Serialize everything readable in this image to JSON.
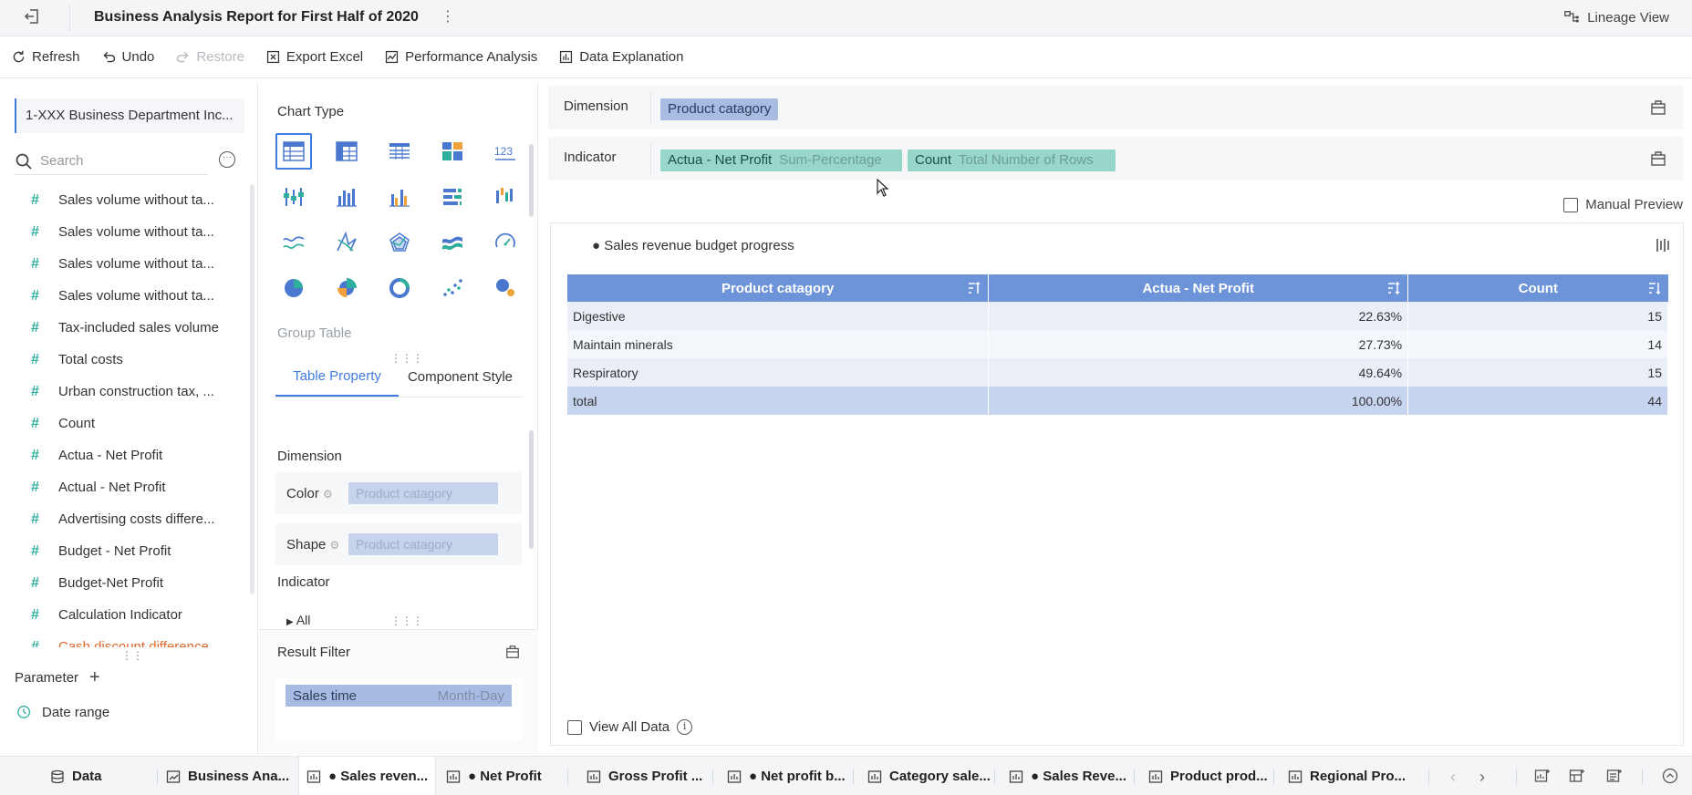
{
  "header": {
    "title": "Business Analysis Report for First Half of 2020",
    "lineage_label": "Lineage View"
  },
  "toolbar": {
    "refresh": "Refresh",
    "undo": "Undo",
    "restore": "Restore",
    "export_excel": "Export Excel",
    "performance_analysis": "Performance Analysis",
    "data_explanation": "Data Explanation"
  },
  "left_panel": {
    "dataset": "1-XXX Business Department Inc...",
    "search_placeholder": "Search",
    "fields": [
      {
        "label": "Sales volume without ta...",
        "icon": "hash-icon"
      },
      {
        "label": "Sales volume without ta...",
        "icon": "hash-icon"
      },
      {
        "label": "Sales volume without ta...",
        "icon": "hash-icon"
      },
      {
        "label": "Sales volume without ta...",
        "icon": "hash-icon"
      },
      {
        "label": "Tax-included sales volume",
        "icon": "hash-icon"
      },
      {
        "label": "Total costs",
        "icon": "hash-icon"
      },
      {
        "label": "Urban construction tax, ...",
        "icon": "hash-icon"
      },
      {
        "label": "Count",
        "icon": "hash-sparkle-icon"
      },
      {
        "label": "Actua - Net Profit",
        "icon": "hash-calc-icon"
      },
      {
        "label": "Actual - Net Profit",
        "icon": "hash-calc-icon"
      },
      {
        "label": "Advertising costs differe...",
        "icon": "hash-calc-icon"
      },
      {
        "label": "Budget - Net Profit",
        "icon": "hash-calc-icon"
      },
      {
        "label": "Budget-Net Profit",
        "icon": "hash-calc-icon"
      },
      {
        "label": "Calculation Indicator",
        "icon": "hash-calc-icon"
      },
      {
        "label": "Cash discount difference",
        "icon": "hash-calc-icon"
      }
    ],
    "parameter_label": "Parameter",
    "date_range_label": "Date range"
  },
  "middle_panel": {
    "chart_type_label": "Chart Type",
    "chart_types": [
      "group-table-icon",
      "cross-table-icon",
      "detail-table-icon",
      "kpi-card-icon",
      "number-icon",
      "custom-chart-icon",
      "column-chart-icon",
      "grouped-column-icon",
      "bar-chart-icon",
      "waterfall-icon",
      "line-chart-icon",
      "radar-icon",
      "range-radar-icon",
      "area-chart-icon",
      "gauge-icon",
      "pie-chart-icon",
      "rose-chart-icon",
      "donut-chart-icon",
      "scatter-icon",
      "bubble-icon"
    ],
    "selected_chart_name": "Group Table",
    "tabs": [
      "Table Property",
      "Component Style"
    ],
    "active_tab": "Table Property",
    "dimension_label": "Dimension",
    "color_label": "Color",
    "color_value": "Product catagory",
    "shape_label": "Shape",
    "shape_value": "Product catagory",
    "indicator_label": "Indicator",
    "all_label": "All",
    "result_filter_label": "Result Filter",
    "filter_field": "Sales time",
    "filter_granularity": "Month-Day"
  },
  "right_panel": {
    "dimension_label": "Dimension",
    "dimension_pill": "Product catagory",
    "indicator_label": "Indicator",
    "indicator_pills": [
      {
        "name": "Actua - Net Profit",
        "agg": "Sum-Percentage"
      },
      {
        "name": "Count",
        "agg": "Total Number of Rows"
      }
    ],
    "manual_preview": "Manual Preview",
    "chart_title": "● Sales revenue budget progress",
    "view_all_data": "View All Data",
    "table": {
      "columns": [
        "Product catagory",
        "Actua - Net Profit",
        "Count"
      ],
      "rows": [
        [
          "Digestive",
          "22.63%",
          "15"
        ],
        [
          "Maintain minerals",
          "27.73%",
          "14"
        ],
        [
          "Respiratory",
          "49.64%",
          "15"
        ]
      ],
      "total": [
        "total",
        "100.00%",
        "44"
      ]
    }
  },
  "bottom_tabs": {
    "data": "Data",
    "tabs": [
      {
        "label": "Business Ana...",
        "icon": "dashboard-icon"
      },
      {
        "label": "● Sales reven...",
        "icon": "component-icon"
      },
      {
        "label": "● Net Profit",
        "icon": "component-icon"
      },
      {
        "label": "Gross Profit ...",
        "icon": "component-icon"
      },
      {
        "label": "● Net profit b...",
        "icon": "component-icon"
      },
      {
        "label": "Category sale...",
        "icon": "component-icon"
      },
      {
        "label": "● Sales Reve...",
        "icon": "component-icon"
      },
      {
        "label": "Product prod...",
        "icon": "component-icon"
      },
      {
        "label": "Regional Pro...",
        "icon": "component-icon"
      }
    ],
    "active_index": 1
  }
}
